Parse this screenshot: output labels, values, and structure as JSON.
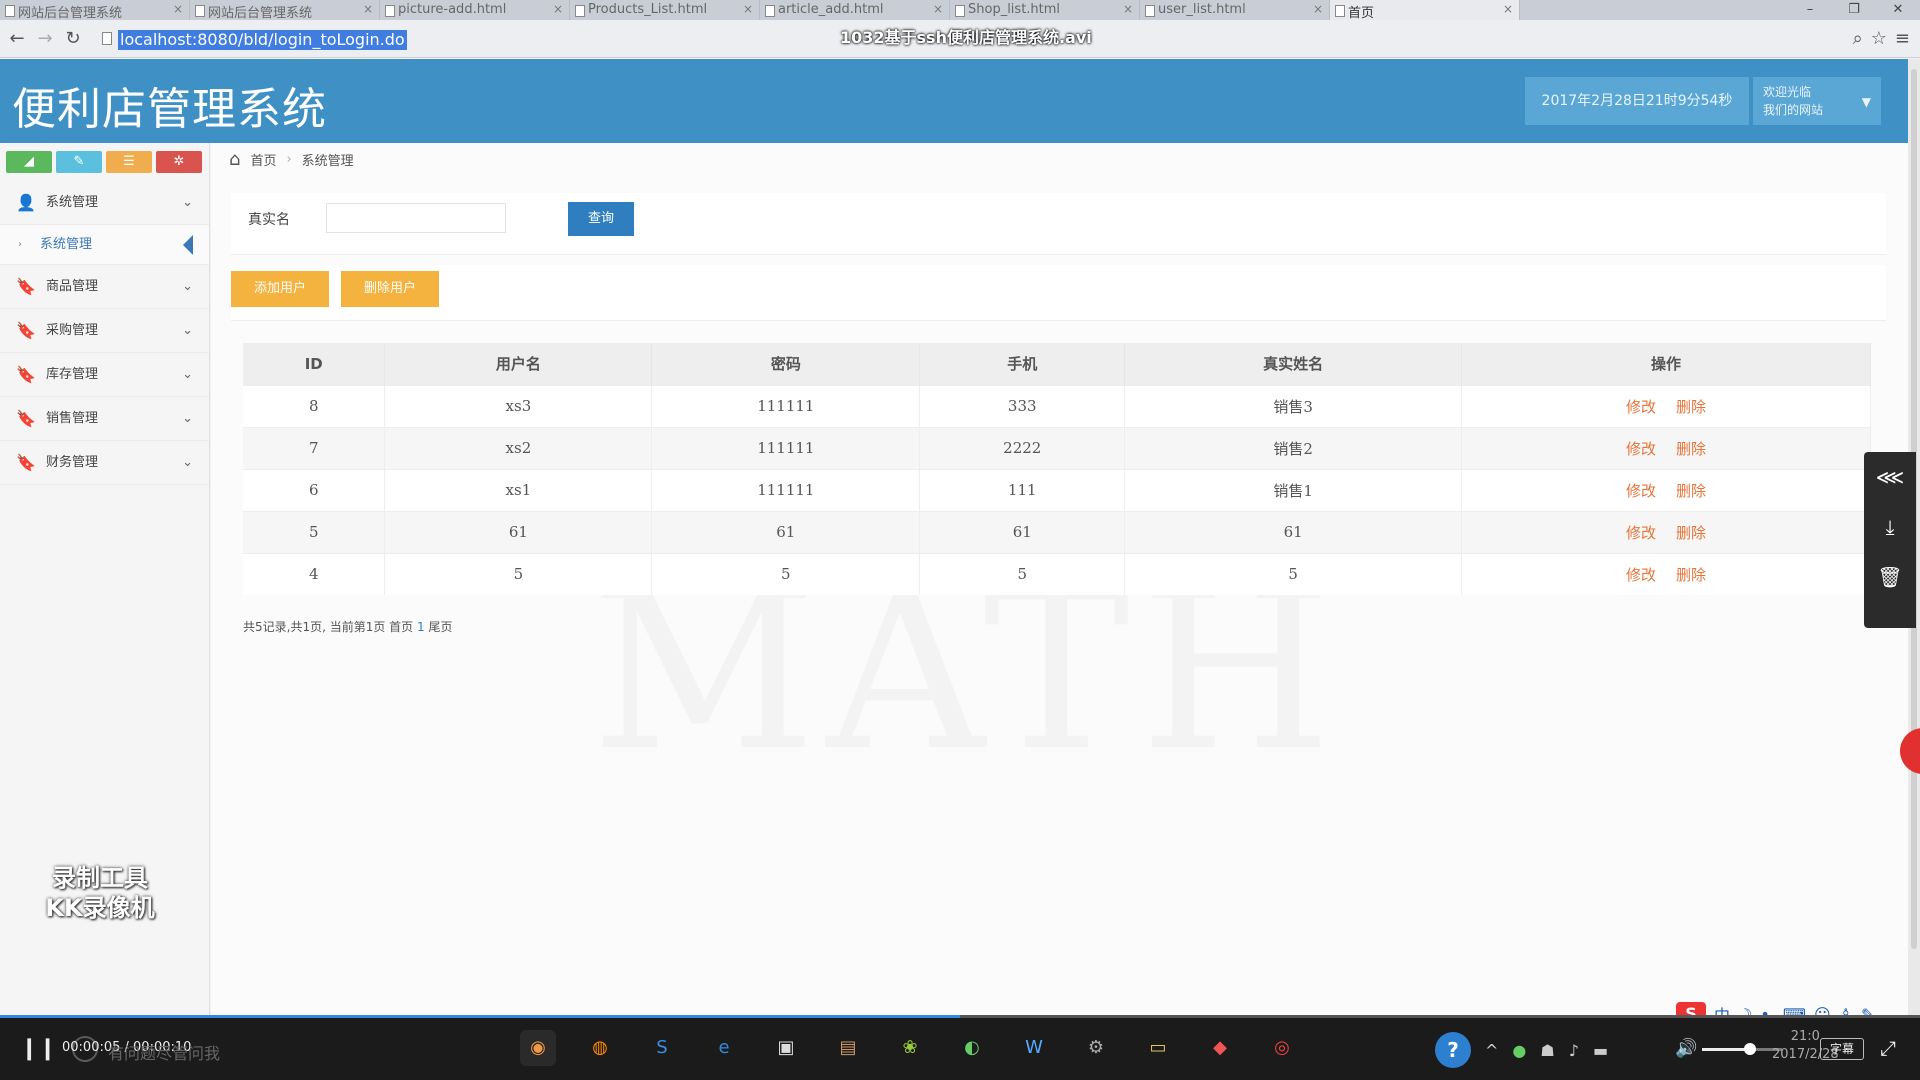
{
  "browser": {
    "tabs": [
      {
        "label": "网站后台管理系统"
      },
      {
        "label": "网站后台管理系统"
      },
      {
        "label": "picture-add.html"
      },
      {
        "label": "Products_List.html"
      },
      {
        "label": "article_add.html"
      },
      {
        "label": "Shop_list.html"
      },
      {
        "label": "user_list.html"
      },
      {
        "label": "首页"
      }
    ],
    "url": "localhost:8080/bld/login_toLogin.do",
    "video_title": "1032基于ssh便利店管理系统.avi"
  },
  "header": {
    "title": "便利店管理系统",
    "datetime": "2017年2月28日21时9分54秒",
    "welcome_line1": "欢迎光临",
    "welcome_line2": "我们的网站"
  },
  "sidebar": {
    "shortcuts": [
      {
        "icon": "chart-icon",
        "glyph": "◢",
        "color": "#5cb85c"
      },
      {
        "icon": "pencil-icon",
        "glyph": "✎",
        "color": "#5bc0de"
      },
      {
        "icon": "users-icon",
        "glyph": "☰",
        "color": "#f0ad4e"
      },
      {
        "icon": "cogs-icon",
        "glyph": "✲",
        "color": "#d9534f"
      }
    ],
    "menu": [
      {
        "label": "系统管理",
        "icon": "user-icon"
      },
      {
        "label": "商品管理",
        "icon": "bookmark-icon"
      },
      {
        "label": "采购管理",
        "icon": "bookmark-icon"
      },
      {
        "label": "库存管理",
        "icon": "bookmark-icon"
      },
      {
        "label": "销售管理",
        "icon": "bookmark-icon"
      },
      {
        "label": "财务管理",
        "icon": "bookmark-icon"
      }
    ],
    "submenu_active": "系统管理",
    "watermark_line1": "录制工具",
    "watermark_line2": "KK录像机"
  },
  "breadcrumb": {
    "home": "首页",
    "current": "系统管理"
  },
  "search": {
    "label": "真实名",
    "value": "",
    "button": "查询"
  },
  "actions": {
    "add": "添加用户",
    "delete": "删除用户"
  },
  "table": {
    "headers": [
      "ID",
      "用户名",
      "密码",
      "手机",
      "真实姓名",
      "操作"
    ],
    "rows": [
      [
        "8",
        "xs3",
        "111111",
        "333",
        "销售3"
      ],
      [
        "7",
        "xs2",
        "111111",
        "2222",
        "销售2"
      ],
      [
        "6",
        "xs1",
        "111111",
        "111",
        "销售1"
      ],
      [
        "5",
        "61",
        "61",
        "61",
        "61"
      ],
      [
        "4",
        "5",
        "5",
        "5",
        "5"
      ]
    ],
    "edit_label": "修改",
    "delete_label": "删除"
  },
  "pagination": {
    "summary": "共5记录,共1页, 当前第1页 首页",
    "current": "1",
    "last": "尾页"
  },
  "background_watermark": "MATH",
  "player": {
    "time": "00:00:05 / 00:00:10",
    "progress": 0.5,
    "volume": 0.6,
    "subtitle": "字幕",
    "clock_time": "21:0",
    "clock_date": "2017/2/28",
    "search_hint": "有问题尽管问我"
  },
  "colors": {
    "header": "#3e90c5",
    "primary_button": "#2f7fc0",
    "orange_button": "#f4b33f",
    "link_orange": "#e6743a"
  }
}
